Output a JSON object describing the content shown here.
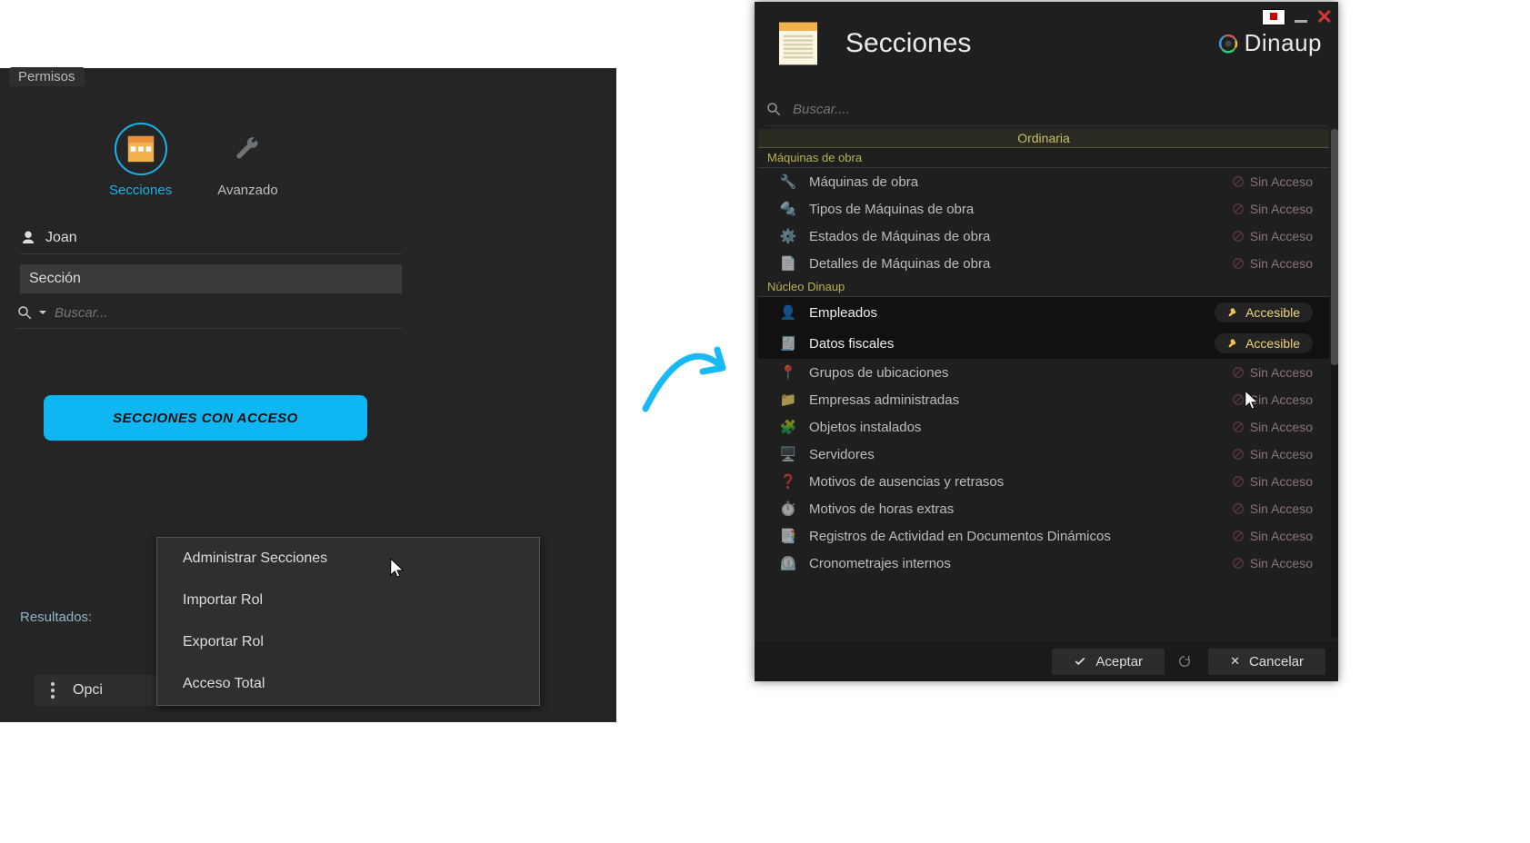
{
  "left": {
    "permisos_tab": "Permisos",
    "modes": {
      "secciones": "Secciones",
      "avanzado": "Avanzado"
    },
    "user": "Joan",
    "section_label": "Sección",
    "search_placeholder": "Buscar...",
    "blue_button": "SECCIONES CON ACCESO",
    "context_menu": {
      "item0": "Administrar Secciones",
      "item1": "Importar Rol",
      "item2": "Exportar Rol",
      "item3": "Acceso Total"
    },
    "results_label": "Resultados:",
    "options_label": "Opci"
  },
  "dialog": {
    "title": "Secciones",
    "brand": "Dinaup",
    "search_placeholder": "Buscar....",
    "category": "Ordinaria",
    "group1": "Máquinas de obra",
    "group2": "Núcleo Dinaup",
    "status_no": "Sin Acceso",
    "status_yes": "Accesible",
    "rows_g1": {
      "r0": "Máquinas de obra",
      "r1": "Tipos de Máquinas de obra",
      "r2": "Estados de Máquinas de obra",
      "r3": "Detalles de Máquinas de obra"
    },
    "rows_g2": {
      "r0": "Empleados",
      "r1": "Datos fiscales",
      "r2": "Grupos de ubicaciones",
      "r3": "Empresas administradas",
      "r4": "Objetos instalados",
      "r5": "Servidores",
      "r6": "Motivos de ausencias y retrasos",
      "r7": "Motivos de horas extras",
      "r8": "Registros de Actividad en Documentos Dinámicos",
      "r9": "Cronometrajes internos"
    },
    "accept": "Aceptar",
    "cancel": "Cancelar"
  }
}
